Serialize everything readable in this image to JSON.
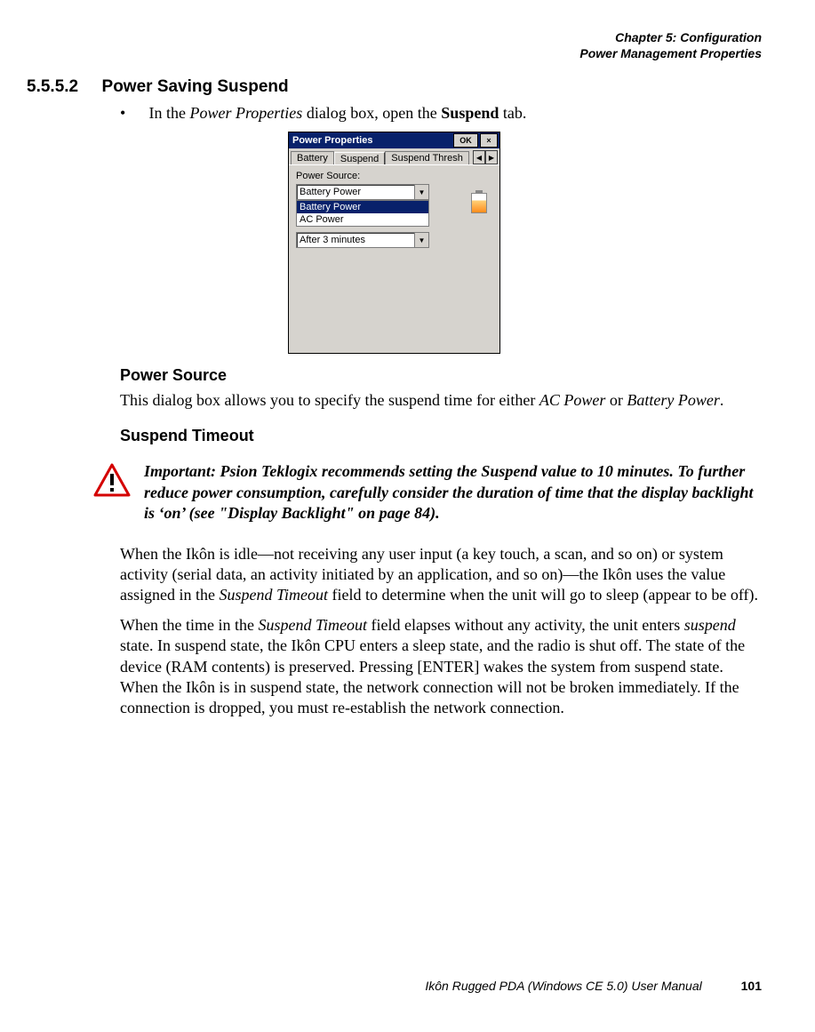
{
  "header": {
    "chapter": "Chapter 5: Configuration",
    "section": "Power Management Properties"
  },
  "heading": {
    "number": "5.5.5.2",
    "title": "Power Saving Suspend"
  },
  "intro": {
    "bullet": "•",
    "prefix": "In the ",
    "dialog_name": "Power Properties",
    "middle": " dialog box, open the ",
    "tab_name": "Suspend",
    "suffix": " tab."
  },
  "dialog": {
    "title": "Power Properties",
    "ok": "OK",
    "close": "×",
    "tabs": [
      "Battery",
      "Suspend",
      "Suspend Thresh"
    ],
    "tab_arrows": {
      "left": "◀",
      "right": "▶"
    },
    "label_power_source": "Power Source:",
    "combo_value": "Battery Power",
    "list_items": [
      "Battery Power",
      "AC Power"
    ],
    "combo2_value": "After 3 minutes",
    "dropdown_glyph": "▼"
  },
  "sub1": {
    "title": "Power Source",
    "para_a": "This dialog box allows you to specify the suspend time for either ",
    "ac": "AC Power",
    "para_b": " or ",
    "bp": "Battery Power",
    "para_c": "."
  },
  "sub2": {
    "title": "Suspend Timeout"
  },
  "important": {
    "label": "Important:",
    "text": "Psion Teklogix recommends setting the Suspend value to 10 minutes. To further reduce power consumption, carefully consider the duration of time that the display backlight is ‘on’ (see \"Display Backlight\" on page 84)."
  },
  "para1": {
    "a": "When the Ikôn is idle—not receiving any user input (a key touch, a scan, and so on) or system activity (serial data, an activity initiated by an application, and so on)—the Ikôn uses the value assigned in the ",
    "st": "Suspend Timeout",
    "b": " field to determine when the unit will go to sleep (appear to be off)."
  },
  "para2": {
    "a": "When the time in the ",
    "st": "Suspend Timeout",
    "b": " field elapses without any activity, the unit enters ",
    "suspend": "suspend",
    "c": " state. In suspend state, the Ikôn CPU enters a sleep state, and the radio is shut off. The state of the device (RAM contents) is preserved. Pressing [ENTER] wakes the system from suspend state. When the Ikôn is in suspend state, the network connection will not be broken immediately. If the connection is dropped, you must re-establish the network connection."
  },
  "footer": {
    "text": "Ikôn Rugged PDA (Windows CE 5.0) User Manual",
    "page": "101"
  }
}
